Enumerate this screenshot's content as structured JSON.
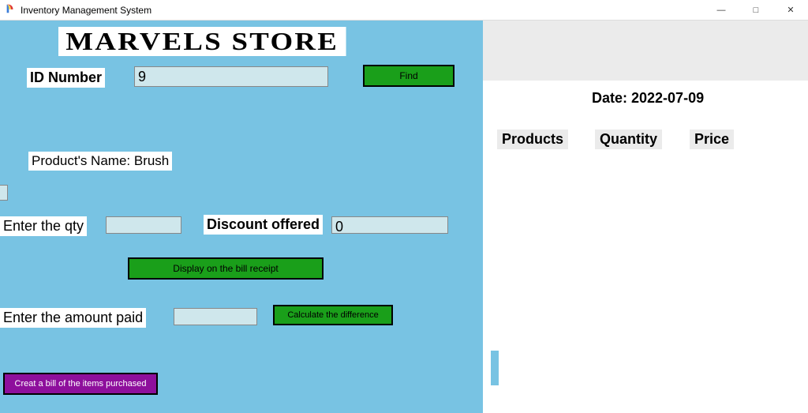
{
  "window": {
    "title": "Inventory Management System"
  },
  "store": {
    "title": "MARVELS STORE"
  },
  "form": {
    "id_label": "ID Number",
    "id_value": "9",
    "find_label": "Find",
    "product_name_label": "Product's Name: Brush",
    "qty_label": "Enter the qty",
    "qty_value": "",
    "discount_label": "Discount offered",
    "discount_value": "0",
    "display_btn": "Display on the bill receipt",
    "amount_label": "Enter the amount paid",
    "amount_value": "",
    "calc_btn": "Calculate the difference",
    "create_bill_btn": "Creat a bill of the items purchased"
  },
  "receipt": {
    "date_label": "Date: 2022-07-09",
    "col_products": "Products",
    "col_quantity": "Quantity",
    "col_price": "Price"
  }
}
